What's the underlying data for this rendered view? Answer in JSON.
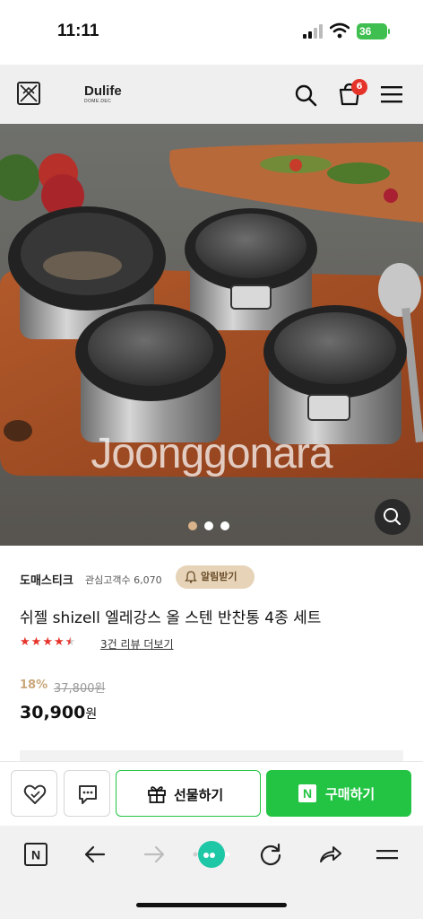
{
  "status_bar": {
    "time": "11:11",
    "battery": "36"
  },
  "header": {
    "logo": "Dulife",
    "logo_sub": "DOME.DEC",
    "cart_count": "6"
  },
  "hero": {
    "watermark": "Joonggonara",
    "slide_count": 3,
    "active_slide": 1
  },
  "product": {
    "store": "도매스티크",
    "visitors": "관심고객수 6,070",
    "notify_label": "알림받기",
    "title": "쉬젤 shizell 엘레강스 올 스텐 반찬통 4종 세트",
    "rating": 4.5,
    "review_link": "3건 리뷰 더보기",
    "discount": "18%",
    "original_price": "37,800원",
    "sale_price": "30,900",
    "sale_unit": "원"
  },
  "actions": {
    "gift_label": "선물하기",
    "buy_label": "구매하기",
    "naver_letter": "N"
  },
  "browser": {
    "tab_letter": "N"
  },
  "colors": {
    "accent_green": "#23c443",
    "badge_red": "#e5332a",
    "notify_bg": "#e6d3b8",
    "discount_gold": "#c9a77b"
  }
}
